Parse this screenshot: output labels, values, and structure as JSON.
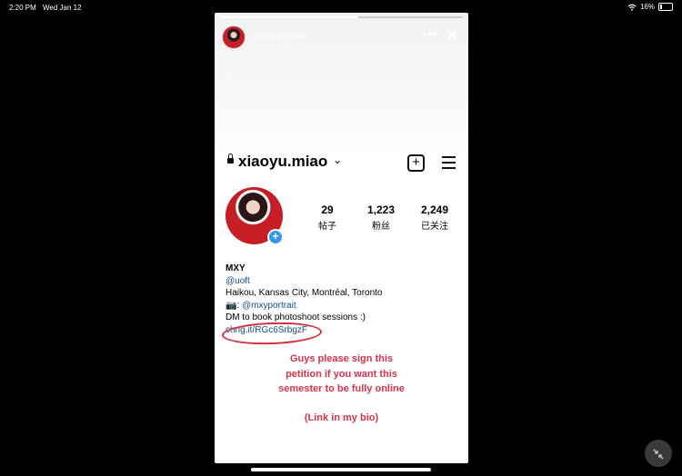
{
  "status_bar": {
    "time": "2:20 PM",
    "date": "Wed Jan 12",
    "battery": "16%",
    "wifi_icon": "wifi-icon"
  },
  "story": {
    "username": "xiaoyu.miao",
    "time_ago": "2m",
    "more_label": "•••",
    "close_label": "✕",
    "progress": 0.57
  },
  "profile": {
    "username": "xiaoyu.miao",
    "chevron": "⌄",
    "add_label": "+",
    "stats": [
      {
        "value": "29",
        "label": "帖子"
      },
      {
        "value": "1,223",
        "label": "粉丝"
      },
      {
        "value": "2,249",
        "label": "已关注"
      }
    ],
    "bio": {
      "name": "MXY",
      "school": "@uoft",
      "locations": "Haikou, Kansas City, Montréal, Toronto",
      "camera_prefix": "📷: ",
      "portrait_tag": "@mxyportrait",
      "booking": "DM to book photoshoot sessions :)",
      "link": "chng.it/RGc6SrbgzF"
    }
  },
  "overlay_text": {
    "petition_lines": [
      "Guys please sign this",
      "petition if you want this",
      "semester to be fully online"
    ],
    "link_note": "(Link in my bio)",
    "color": "#d8344a"
  },
  "colors": {
    "background": "#000000",
    "link": "#1a4c85",
    "circle": "#d3303d",
    "plus_badge": "#3897f0"
  }
}
